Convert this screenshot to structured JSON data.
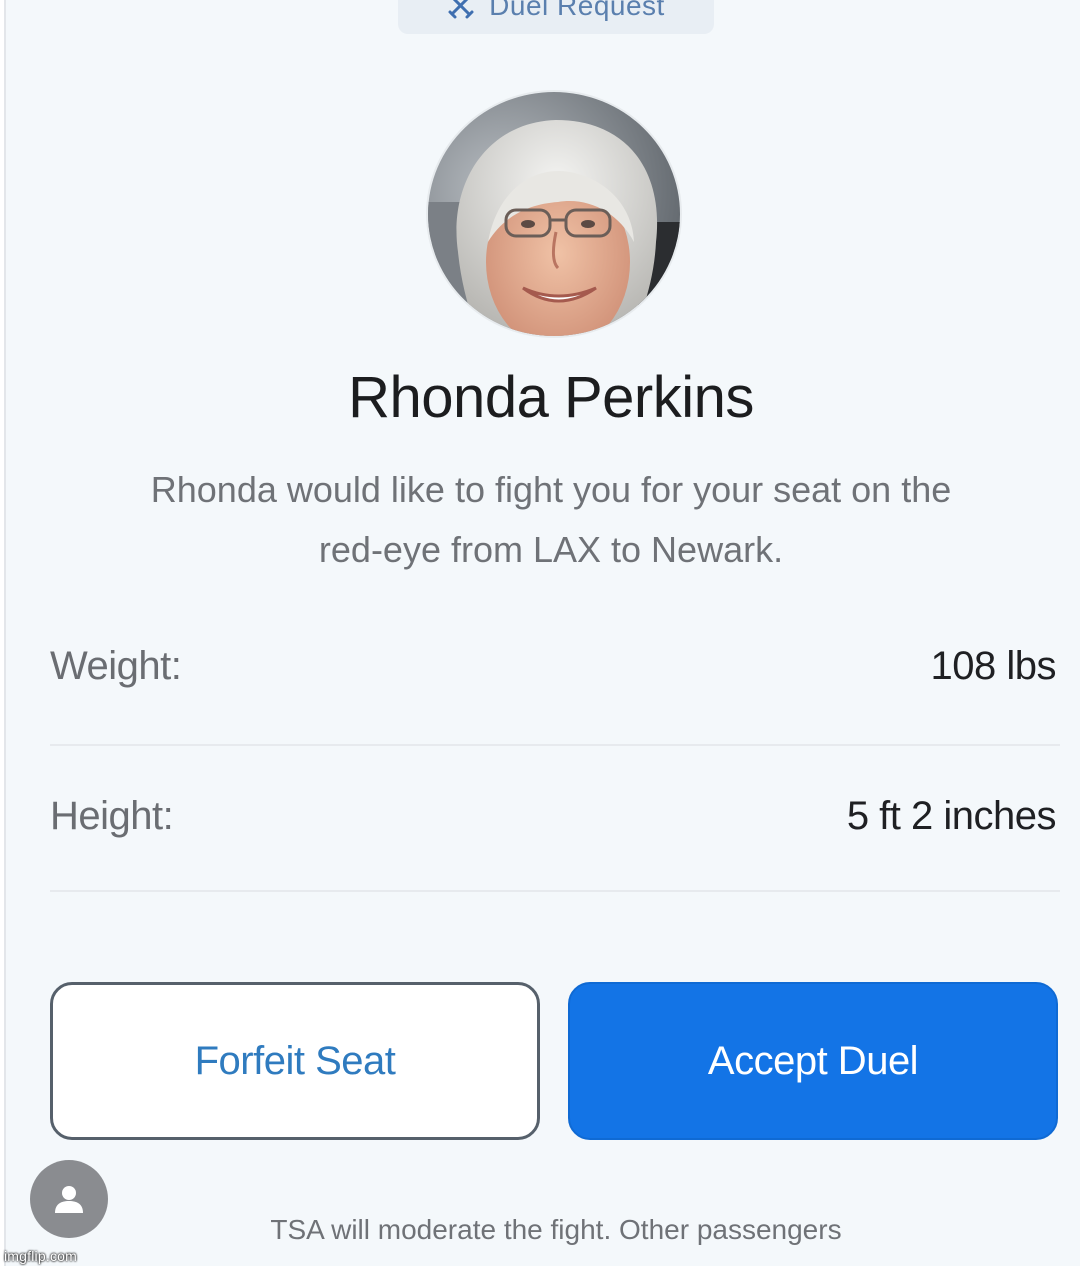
{
  "header": {
    "chip_label": "Duel Request",
    "chip_icon": "crossed-swords-icon"
  },
  "profile": {
    "avatar": "profile-photo",
    "name": "Rhonda Perkins",
    "message": "Rhonda would like to fight you for your seat on the red-eye from LAX to Newark."
  },
  "stats": [
    {
      "label": "Weight:",
      "value": "108 lbs"
    },
    {
      "label": "Height:",
      "value": "5 ft 2 inches"
    }
  ],
  "actions": {
    "forfeit_label": "Forfeit Seat",
    "accept_label": "Accept Duel"
  },
  "footer": {
    "note": "TSA will moderate the fight. Other passengers",
    "fab_icon": "person-icon"
  },
  "watermark": "imgflip.com",
  "colors": {
    "background": "#f4f8fb",
    "accent": "#1374e6",
    "link": "#2f7bbf",
    "chip_text": "#5a7fae"
  }
}
